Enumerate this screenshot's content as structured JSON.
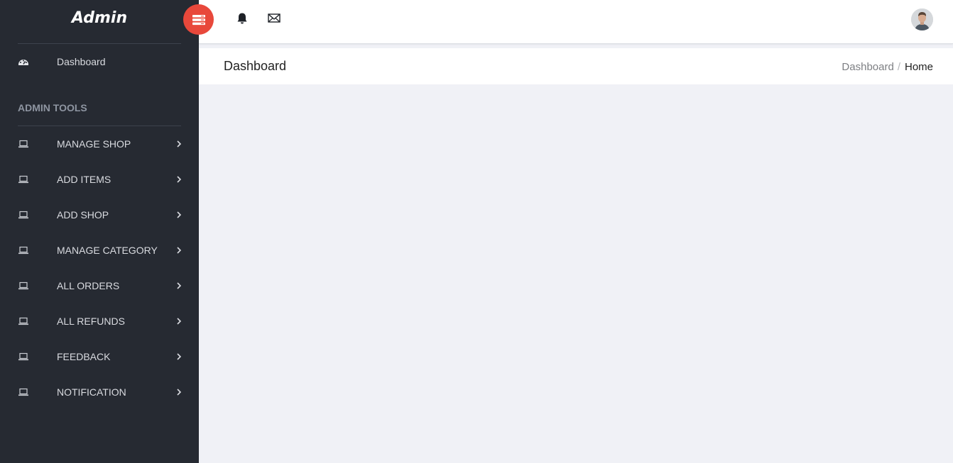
{
  "brand": {
    "title": "Admin"
  },
  "sidebar": {
    "dashboard": {
      "label": "Dashboard",
      "icon": "dashboard-gauge-icon"
    },
    "section_title": "ADMIN TOOLS",
    "items": [
      {
        "label": "MANAGE SHOP",
        "icon": "laptop-icon"
      },
      {
        "label": "ADD ITEMS",
        "icon": "laptop-icon"
      },
      {
        "label": "ADD SHOP",
        "icon": "laptop-icon"
      },
      {
        "label": "MANAGE CATEGORY",
        "icon": "laptop-icon"
      },
      {
        "label": "ALL ORDERS",
        "icon": "laptop-icon"
      },
      {
        "label": "ALL REFUNDS",
        "icon": "laptop-icon"
      },
      {
        "label": "FEEDBACK",
        "icon": "laptop-icon"
      },
      {
        "label": "NOTIFICATION",
        "icon": "laptop-icon"
      }
    ]
  },
  "topbar": {
    "toggle_icon": "menu-toggle-icon",
    "icons": [
      "bell-icon",
      "envelope-icon"
    ],
    "avatar": "user-avatar"
  },
  "page": {
    "title": "Dashboard",
    "breadcrumb": {
      "link": "Dashboard",
      "separator": "/",
      "current": "Home"
    }
  },
  "colors": {
    "sidebar_bg": "#262a32",
    "content_bg": "#f0f1f6",
    "accent": "#e8483b"
  }
}
